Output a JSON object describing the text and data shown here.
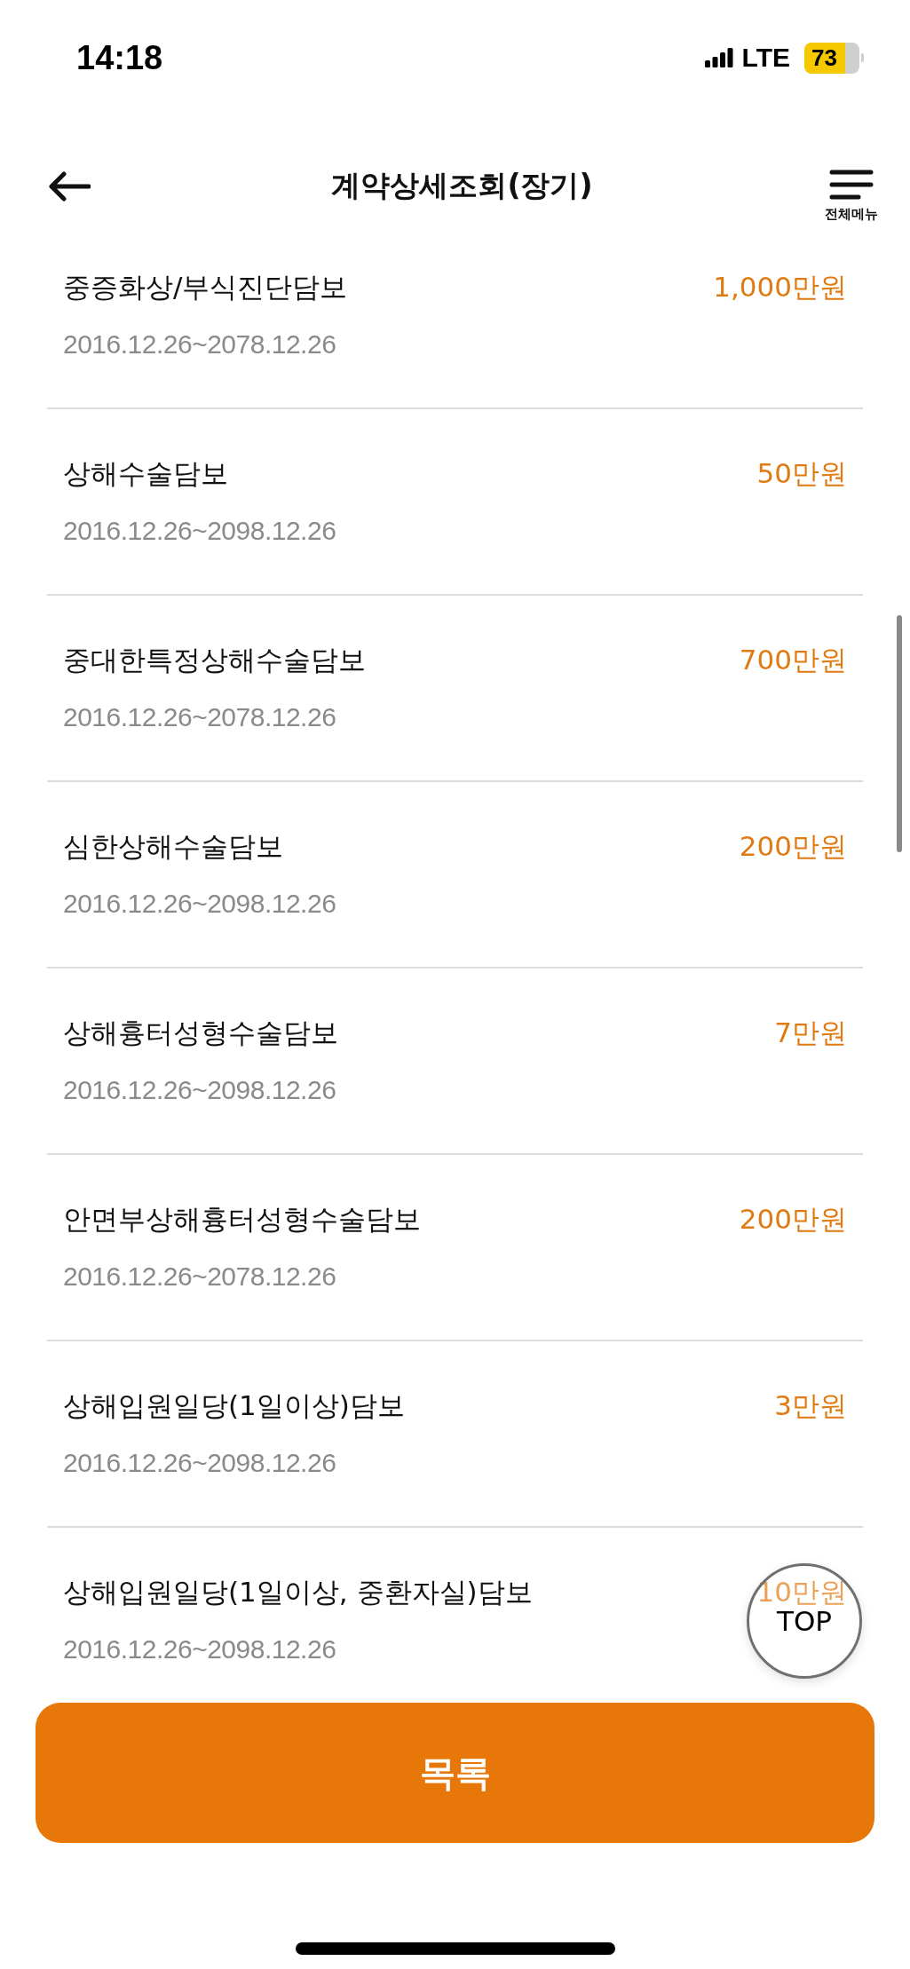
{
  "status_bar": {
    "time": "14:18",
    "network": "LTE",
    "battery": "73"
  },
  "header": {
    "title": "계약상세조회(장기)",
    "menu_label": "전체메뉴"
  },
  "coverages": [
    {
      "name": "중증화상/부식진단담보",
      "period": "2016.12.26~2078.12.26",
      "amount": "1,000만원"
    },
    {
      "name": "상해수술담보",
      "period": "2016.12.26~2098.12.26",
      "amount": "50만원"
    },
    {
      "name": "중대한특정상해수술담보",
      "period": "2016.12.26~2078.12.26",
      "amount": "700만원"
    },
    {
      "name": "심한상해수술담보",
      "period": "2016.12.26~2098.12.26",
      "amount": "200만원"
    },
    {
      "name": "상해흉터성형수술담보",
      "period": "2016.12.26~2098.12.26",
      "amount": "7만원"
    },
    {
      "name": "안면부상해흉터성형수술담보",
      "period": "2016.12.26~2078.12.26",
      "amount": "200만원"
    },
    {
      "name": "상해입원일당(1일이상)담보",
      "period": "2016.12.26~2098.12.26",
      "amount": "3만원"
    },
    {
      "name": "상해입원일당(1일이상, 중환자실)담보",
      "period": "2016.12.26~2098.12.26",
      "amount": "10만원"
    }
  ],
  "top_button": "TOP",
  "list_button": "목록"
}
